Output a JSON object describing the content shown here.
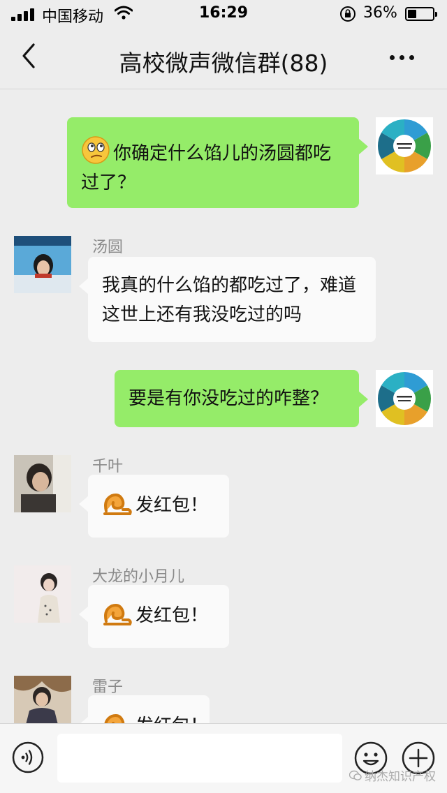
{
  "status_bar": {
    "carrier": "中国移动",
    "time": "16:29",
    "battery_percent": "36%",
    "battery_level": 0.36
  },
  "nav": {
    "title": "高校微声微信群(88)"
  },
  "messages": [
    {
      "id": "m1",
      "direction": "outgoing",
      "text": "你确定什么馅儿的汤圆都吃过了？",
      "leading_emoji": "thinking-emoji",
      "avatar": "group-logo-avatar"
    },
    {
      "id": "m2",
      "direction": "incoming",
      "sender": "汤圆",
      "text": "我真的什么馅的都吃过了，难道这世上还有我没吃过的吗",
      "avatar": "user-avatar"
    },
    {
      "id": "m3",
      "direction": "outgoing",
      "text": "要是有你没吃过的咋整？",
      "avatar": "group-logo-avatar"
    },
    {
      "id": "m4",
      "direction": "incoming",
      "sender": "千叶",
      "text": "发红包！",
      "leading_emoji": "red-packet-emoji",
      "avatar": "user-avatar"
    },
    {
      "id": "m5",
      "direction": "incoming",
      "sender": "大龙的小月儿",
      "text": "发红包！",
      "leading_emoji": "red-packet-emoji",
      "avatar": "user-avatar"
    },
    {
      "id": "m6",
      "direction": "incoming",
      "sender": "雷子",
      "text": "发红包！",
      "leading_emoji": "red-packet-emoji",
      "avatar": "user-avatar"
    }
  ],
  "input_bar": {
    "placeholder": "",
    "value": ""
  },
  "watermark": {
    "text": "纳杰知识产权"
  },
  "colors": {
    "background": "#ededed",
    "outgoing_bubble": "#95ec69",
    "incoming_bubble": "#fafafa",
    "sender_name": "#8a8a8a"
  }
}
